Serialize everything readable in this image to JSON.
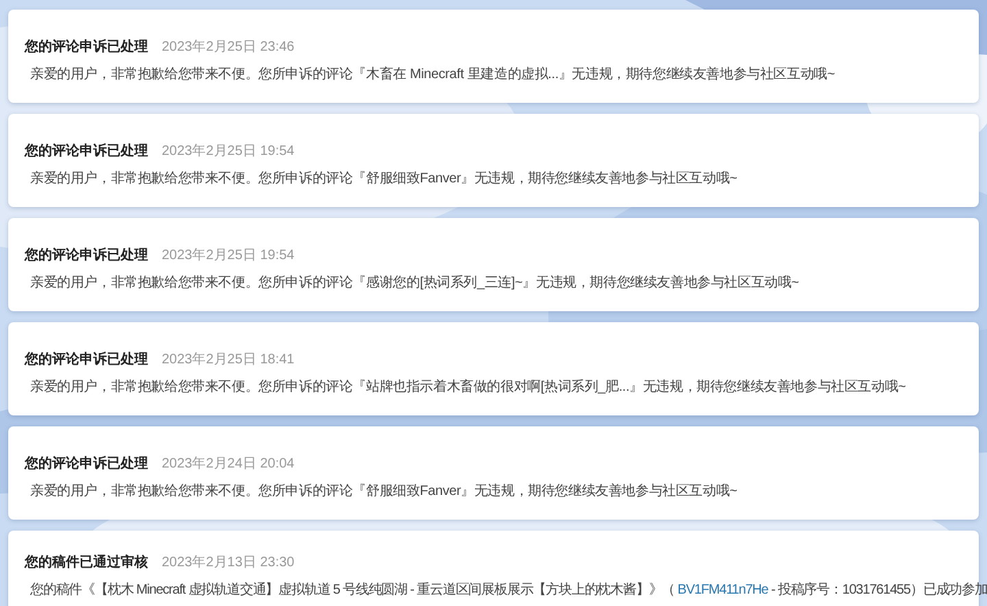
{
  "notifications": [
    {
      "title": "您的评论申诉已处理",
      "time": "2023年2月25日 23:46",
      "message": [
        {
          "kind": "text",
          "text": "亲爱的用户，非常抱歉给您带来不便。您所申诉的评论『木畜在 Minecraft 里建造的虚拟...』无违规，期待您继续友善地参与社区互动哦~"
        }
      ]
    },
    {
      "title": "您的评论申诉已处理",
      "time": "2023年2月25日 19:54",
      "message": [
        {
          "kind": "text",
          "text": "亲爱的用户，非常抱歉给您带来不便。您所申诉的评论『舒服细致Fanver』无违规，期待您继续友善地参与社区互动哦~"
        }
      ]
    },
    {
      "title": "您的评论申诉已处理",
      "time": "2023年2月25日 19:54",
      "message": [
        {
          "kind": "text",
          "text": "亲爱的用户，非常抱歉给您带来不便。您所申诉的评论『感谢您的[热词系列_三连]~』无违规，期待您继续友善地参与社区互动哦~"
        }
      ]
    },
    {
      "title": "您的评论申诉已处理",
      "time": "2023年2月25日 18:41",
      "message": [
        {
          "kind": "text",
          "text": "亲爱的用户，非常抱歉给您带来不便。您所申诉的评论『站牌也指示着木畜做的很对啊[热词系列_肥...』无违规，期待您继续友善地参与社区互动哦~"
        }
      ]
    },
    {
      "title": "您的评论申诉已处理",
      "time": "2023年2月24日 20:04",
      "message": [
        {
          "kind": "text",
          "text": "亲爱的用户，非常抱歉给您带来不便。您所申诉的评论『舒服细致Fanver』无违规，期待您继续友善地参与社区互动哦~"
        }
      ]
    },
    {
      "title": "您的稿件已通过审核",
      "time": "2023年2月13日 23:30",
      "message": [
        {
          "kind": "text",
          "text": "您的稿件《【枕木 Minecraft 虚拟轨道交通】虚拟轨道 5 号线纯圆湖 - 重云道区间展板展示【方块上的枕木酱】》（ "
        },
        {
          "kind": "link",
          "text": "BV1FM411n7He"
        },
        {
          "kind": "text",
          "text": " - 投稿序号：1031761455）已成功参加"
        }
      ]
    }
  ]
}
